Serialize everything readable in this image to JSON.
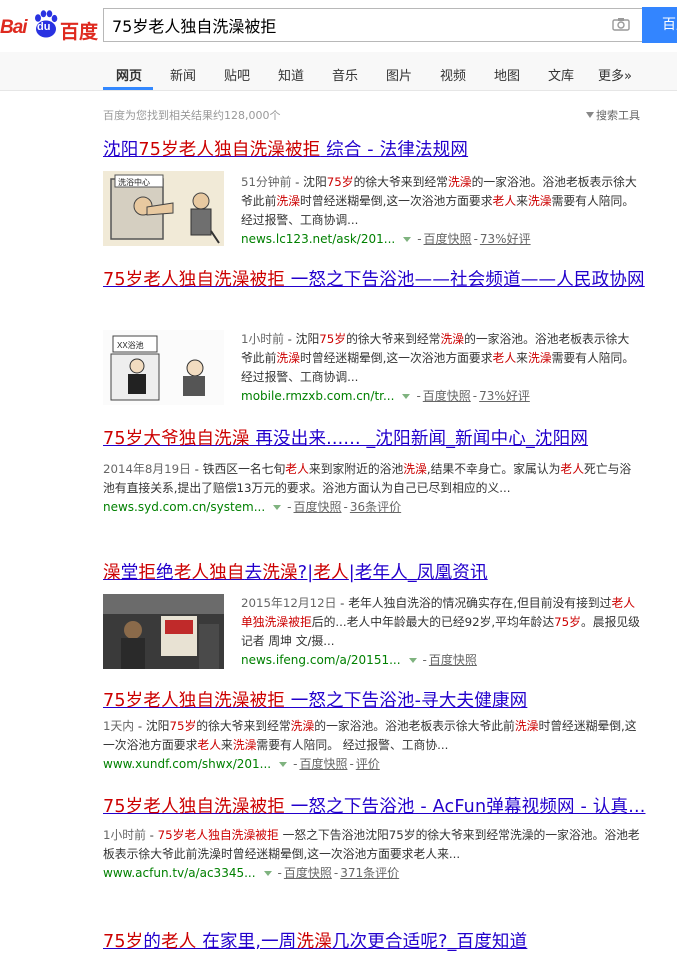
{
  "logo": {
    "part1": "Bai",
    "part2": "du",
    "part3": "百度"
  },
  "search": {
    "query": "75岁老人独自洗澡被拒",
    "button": "百度一下",
    "camera_icon": "camera-icon"
  },
  "tabs": [
    {
      "label": "网页",
      "active": true
    },
    {
      "label": "新闻"
    },
    {
      "label": "贴吧"
    },
    {
      "label": "知道"
    },
    {
      "label": "音乐"
    },
    {
      "label": "图片"
    },
    {
      "label": "视频"
    },
    {
      "label": "地图"
    },
    {
      "label": "文库"
    },
    {
      "label": "更多»"
    }
  ],
  "stats": "百度为您找到相关结果约128,000个",
  "tools": "搜索工具",
  "results": [
    {
      "title_parts": [
        {
          "t": "沈阳",
          "h": false
        },
        {
          "t": "75岁老人独自洗澡被拒",
          "h": true
        },
        {
          "t": " 综合 - 法律法规网",
          "h": false
        }
      ],
      "thumb": "cartoon: bathhouse (洗浴中心) refusing old man",
      "thumb_text": "洗浴中心",
      "text_parts": [
        {
          "t": "51分钟前",
          "d": true
        },
        {
          "t": " - 沈阳"
        },
        {
          "t": "75岁",
          "h": true
        },
        {
          "t": "的徐大爷来到经常"
        },
        {
          "t": "洗澡",
          "h": true
        },
        {
          "t": "的一家浴池。浴池老板表示徐大爷此前"
        },
        {
          "t": "洗澡",
          "h": true
        },
        {
          "t": "时曾经迷糊晕倒,这一次浴池方面要求"
        },
        {
          "t": "老人",
          "h": true
        },
        {
          "t": "来"
        },
        {
          "t": "洗澡",
          "h": true
        },
        {
          "t": "需要有人陪同。 经过报警、工商协调..."
        }
      ],
      "url": "news.lc123.net/ask/201...",
      "snapshot": "百度快照",
      "extra": "73%好评"
    },
    {
      "title_parts": [
        {
          "t": "75岁老人独自洗澡被拒",
          "h": true
        },
        {
          "t": " 一怒之下告浴池——社会频道——人民政协网",
          "h": false
        }
      ],
      "thumb": "cartoon: XX浴池 man at counter",
      "thumb_text": "XX浴池",
      "text_parts": [
        {
          "t": "1小时前",
          "d": true
        },
        {
          "t": " - 沈阳"
        },
        {
          "t": "75岁",
          "h": true
        },
        {
          "t": "的徐大爷来到经常"
        },
        {
          "t": "洗澡",
          "h": true
        },
        {
          "t": "的一家浴池。浴池老板表示徐大爷此前"
        },
        {
          "t": "洗澡",
          "h": true
        },
        {
          "t": "时曾经迷糊晕倒,这一次浴池方面要求"
        },
        {
          "t": "老人",
          "h": true
        },
        {
          "t": "来"
        },
        {
          "t": "洗澡",
          "h": true
        },
        {
          "t": "需要有人陪同。 经过报警、工商协调..."
        }
      ],
      "url": "mobile.rmzxb.com.cn/tr...",
      "snapshot": "百度快照",
      "extra": "73%好评"
    },
    {
      "title_parts": [
        {
          "t": "75岁大爷独自洗澡",
          "h": true
        },
        {
          "t": " 再没出来...... _沈阳新闻_新闻中心_沈阳网",
          "h": false
        }
      ],
      "text_parts": [
        {
          "t": "2014年8月19日",
          "d": true
        },
        {
          "t": " - 铁西区一名七旬"
        },
        {
          "t": "老人",
          "h": true
        },
        {
          "t": "来到家附近的浴池"
        },
        {
          "t": "洗澡",
          "h": true
        },
        {
          "t": ",结果不幸身亡。家属认为"
        },
        {
          "t": "老人",
          "h": true
        },
        {
          "t": "死亡与浴池有直接关系,提出了赔偿13万元的要求。浴池方面认为自己已尽到相应的义..."
        }
      ],
      "url": "news.syd.com.cn/system...",
      "snapshot": "百度快照",
      "extra": "36条评价"
    },
    {
      "title_parts": [
        {
          "t": "澡",
          "h": true
        },
        {
          "t": "堂",
          "h": false
        },
        {
          "t": "拒",
          "h": true
        },
        {
          "t": "绝",
          "h": false
        },
        {
          "t": "老人独自",
          "h": true
        },
        {
          "t": "去",
          "h": false
        },
        {
          "t": "洗澡",
          "h": true
        },
        {
          "t": "?|",
          "h": false
        },
        {
          "t": "老人",
          "h": true
        },
        {
          "t": "|老年人_凤凰资讯",
          "h": false
        }
      ],
      "thumb": "photo: man at bathhouse counter",
      "thumb_text": "",
      "text_parts": [
        {
          "t": "2015年12月12日",
          "d": true
        },
        {
          "t": " - 老年人独自洗浴的情况确实存在,但目前没有接到过"
        },
        {
          "t": "老人单独洗澡被拒",
          "h": true
        },
        {
          "t": "后的...老人中年龄最大的已经92岁,平均年龄达"
        },
        {
          "t": "75岁",
          "h": true
        },
        {
          "t": "。晨报见级记者 周坤 文/摄..."
        }
      ],
      "url": "news.ifeng.com/a/20151...",
      "snapshot": "百度快照",
      "extra": ""
    },
    {
      "title_parts": [
        {
          "t": "75岁老人独自洗澡被拒",
          "h": true
        },
        {
          "t": " 一怒之下告浴池-寻大夫健康网",
          "h": false
        }
      ],
      "text_parts": [
        {
          "t": "1天内",
          "d": true
        },
        {
          "t": " - 沈阳"
        },
        {
          "t": "75岁",
          "h": true
        },
        {
          "t": "的徐大爷来到经常"
        },
        {
          "t": "洗澡",
          "h": true
        },
        {
          "t": "的一家浴池。浴池老板表示徐大爷此前"
        },
        {
          "t": "洗澡",
          "h": true
        },
        {
          "t": "时曾经迷糊晕倒,这一次浴池方面要求"
        },
        {
          "t": "老人",
          "h": true
        },
        {
          "t": "来"
        },
        {
          "t": "洗澡",
          "h": true
        },
        {
          "t": "需要有人陪同。 经过报警、工商协..."
        }
      ],
      "url": "www.xundf.com/shwx/201...",
      "snapshot": "百度快照",
      "extra": "评价"
    },
    {
      "title_parts": [
        {
          "t": "75岁老人独自洗澡被拒",
          "h": true
        },
        {
          "t": " 一怒之下告浴池 - AcFun弹幕视频网 - 认真...",
          "h": false
        }
      ],
      "text_parts": [
        {
          "t": "1小时前",
          "d": true
        },
        {
          "t": " - "
        },
        {
          "t": "75岁老人独自洗澡被拒",
          "h": true
        },
        {
          "t": " 一怒之下告浴池沈阳75岁的徐大爷来到经常洗澡的一家浴池。浴池老板表示徐大爷此前洗澡时曾经迷糊晕倒,这一次浴池方面要求老人来..."
        }
      ],
      "url": "www.acfun.tv/a/ac3345...",
      "snapshot": "百度快照",
      "extra": "371条评价"
    },
    {
      "title_parts": [
        {
          "t": "75岁",
          "h": true
        },
        {
          "t": "的",
          "h": false
        },
        {
          "t": "老人",
          "h": true
        },
        {
          "t": " 在家里,一周",
          "h": false
        },
        {
          "t": "洗澡",
          "h": true
        },
        {
          "t": "几次更合适呢?_百度知道",
          "h": false
        }
      ]
    }
  ]
}
